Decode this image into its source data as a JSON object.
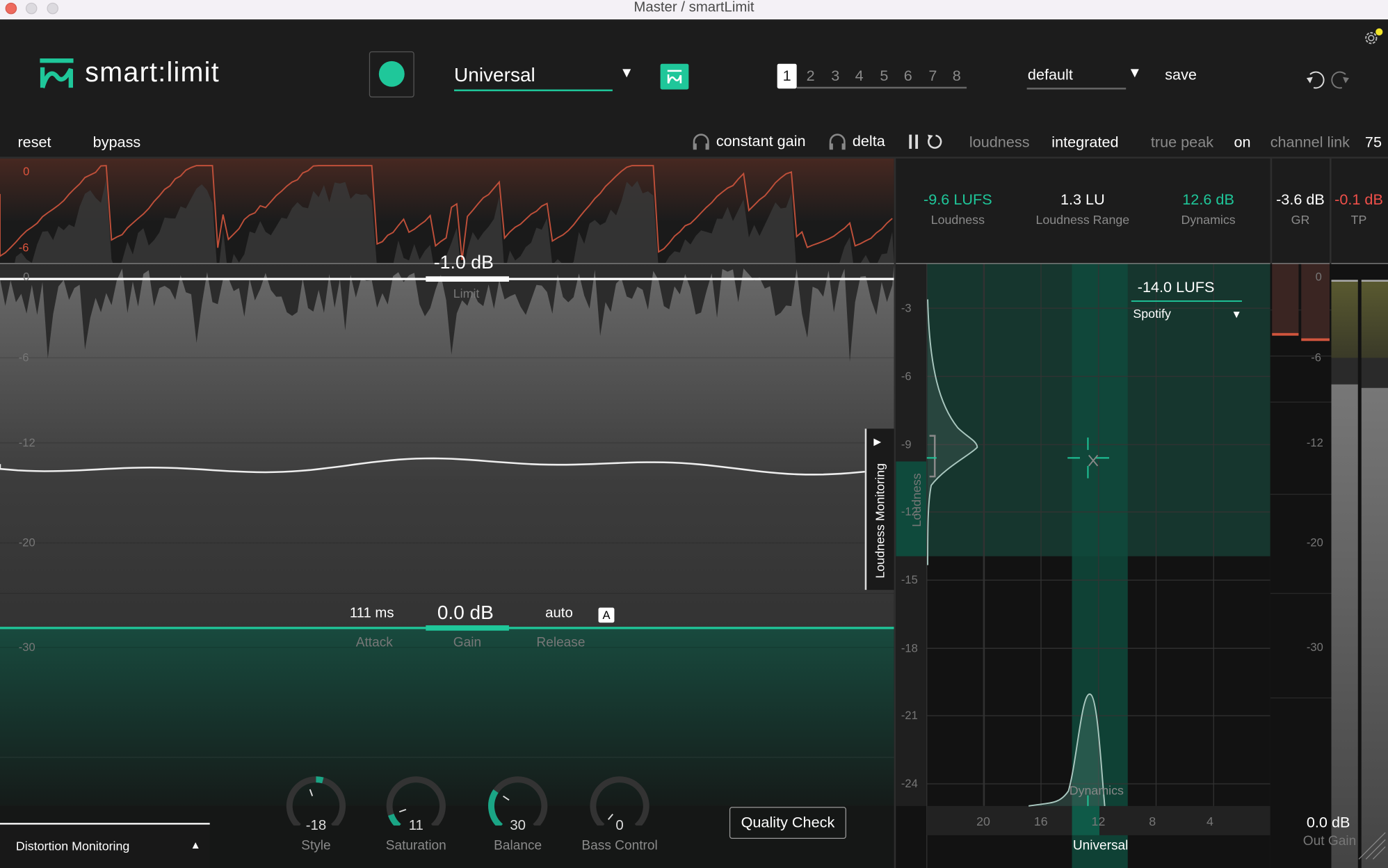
{
  "window": {
    "title": "Master / smartLimit"
  },
  "header": {
    "logo_text": "smart:limit",
    "profile": {
      "value": "Universal"
    },
    "presets": [
      "1",
      "2",
      "3",
      "4",
      "5",
      "6",
      "7",
      "8"
    ],
    "active_preset": "1",
    "preset_name": "default",
    "save_label": "save"
  },
  "toolbar": {
    "reset": "reset",
    "bypass": "bypass",
    "constant_gain": "constant gain",
    "delta": "delta",
    "loudness_label": "loudness",
    "loudness_value": "integrated",
    "true_peak_label": "true peak",
    "true_peak_value": "on",
    "channel_link_label": "channel link",
    "channel_link_value": "75"
  },
  "waveform": {
    "top_scale": [
      "0",
      "-6"
    ],
    "scale": [
      "0",
      "-6",
      "-12",
      "-20",
      "-30"
    ],
    "limit": {
      "value": "-1.0 dB",
      "label": "Limit"
    },
    "attack": {
      "value": "111 ms",
      "label": "Attack"
    },
    "gain": {
      "value": "0.0 dB",
      "label": "Gain"
    },
    "release": {
      "value": "auto",
      "label": "Release",
      "auto_badge": "A"
    },
    "loudness_monitoring_tab": "Loudness Monitoring"
  },
  "stats": [
    {
      "value": "-9.6 LUFS",
      "label": "Loudness",
      "color": "#1fc79a"
    },
    {
      "value": "1.3 LU",
      "label": "Loudness Range",
      "color": "#ffffff"
    },
    {
      "value": "12.6 dB",
      "label": "Dynamics",
      "color": "#1fc79a"
    },
    {
      "value": "-3.6 dB",
      "label": "GR",
      "color": "#ffffff"
    },
    {
      "value": "-0.1 dB",
      "label": "TP",
      "color": "#f0504a"
    }
  ],
  "loudness_chart": {
    "y_ticks": [
      "-3",
      "-6",
      "-9",
      "-12",
      "-15",
      "-18",
      "-21",
      "-24"
    ],
    "x_ticks": [
      "20",
      "16",
      "12",
      "8",
      "4"
    ],
    "y_label": "Loudness",
    "x_label": "Dynamics",
    "target": {
      "value": "-14.0 LUFS",
      "platform": "Spotify"
    },
    "profile_label": "Universal"
  },
  "meters": {
    "scale": [
      "0",
      "-6",
      "-12",
      "-20",
      "-30"
    ],
    "out_gain": {
      "value": "0.0 dB",
      "label": "Out Gain"
    }
  },
  "knobs": [
    {
      "value": "-18",
      "label": "Style",
      "fraction": 0.45
    },
    {
      "value": "11",
      "label": "Saturation",
      "fraction": 0.11
    },
    {
      "value": "30",
      "label": "Balance",
      "fraction": 0.3
    },
    {
      "value": "0",
      "label": "Bass Control",
      "fraction": 0.0
    }
  ],
  "distortion_monitoring": "Distortion Monitoring",
  "quality_check": "Quality Check",
  "colors": {
    "accent": "#1fc79a",
    "limit_red": "#c0503a",
    "tp_red": "#f0504a",
    "background": "#1c1c1c"
  }
}
